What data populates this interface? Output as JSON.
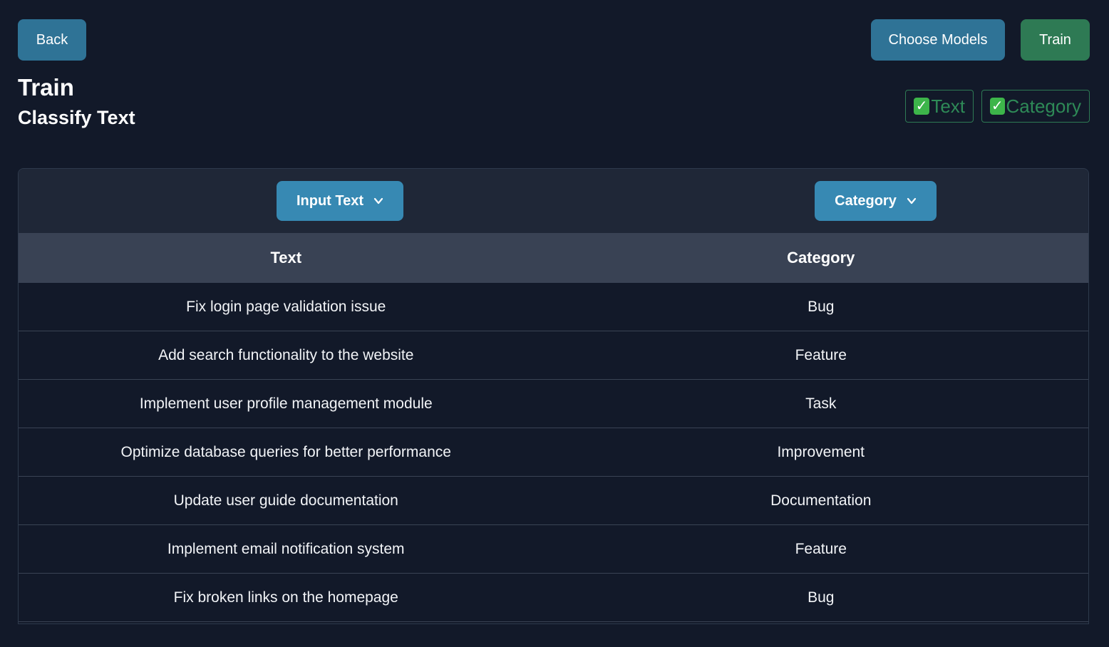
{
  "header": {
    "back_label": "Back",
    "choose_models_label": "Choose Models",
    "train_label": "Train"
  },
  "page": {
    "title": "Train",
    "subtitle": "Classify Text"
  },
  "toggles": [
    {
      "label": "Text",
      "checked": true
    },
    {
      "label": "Category",
      "checked": true
    }
  ],
  "dropdowns": {
    "input_text": "Input Text",
    "category": "Category"
  },
  "table": {
    "columns": [
      "Text",
      "Category"
    ],
    "rows": [
      [
        "Fix login page validation issue",
        "Bug"
      ],
      [
        "Add search functionality to the website",
        "Feature"
      ],
      [
        "Implement user profile management module",
        "Task"
      ],
      [
        "Optimize database queries for better performance",
        "Improvement"
      ],
      [
        "Update user guide documentation",
        "Documentation"
      ],
      [
        "Implement email notification system",
        "Feature"
      ],
      [
        "Fix broken links on the homepage",
        "Bug"
      ]
    ]
  },
  "colors": {
    "background": "#121929",
    "button_blue": "#2f7396",
    "button_green": "#2e7a54",
    "dropdown_blue": "#3789b3",
    "table_header": "#394254",
    "checkmark_green": "#3db54a"
  }
}
